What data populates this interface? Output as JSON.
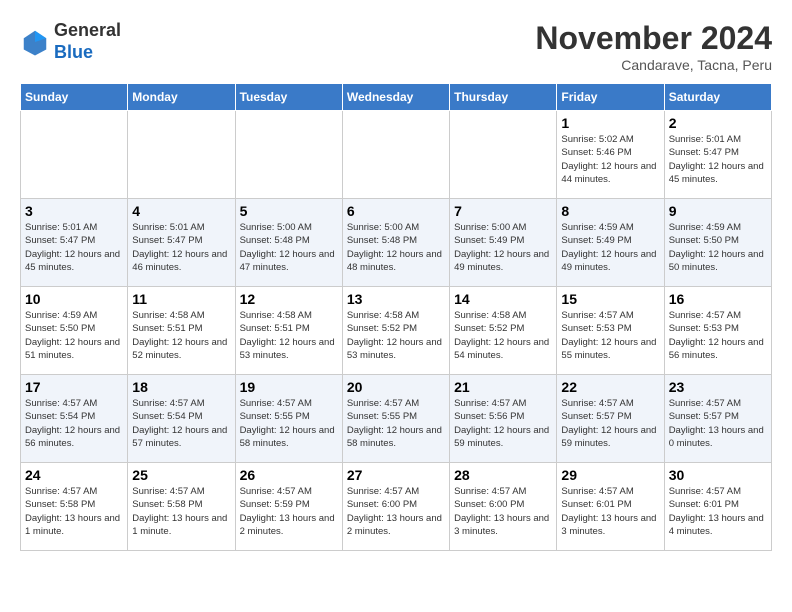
{
  "header": {
    "logo_line1": "General",
    "logo_line2": "Blue",
    "month": "November 2024",
    "location": "Candarave, Tacna, Peru"
  },
  "weekdays": [
    "Sunday",
    "Monday",
    "Tuesday",
    "Wednesday",
    "Thursday",
    "Friday",
    "Saturday"
  ],
  "weeks": [
    [
      {
        "day": "",
        "info": ""
      },
      {
        "day": "",
        "info": ""
      },
      {
        "day": "",
        "info": ""
      },
      {
        "day": "",
        "info": ""
      },
      {
        "day": "",
        "info": ""
      },
      {
        "day": "1",
        "info": "Sunrise: 5:02 AM\nSunset: 5:46 PM\nDaylight: 12 hours\nand 44 minutes."
      },
      {
        "day": "2",
        "info": "Sunrise: 5:01 AM\nSunset: 5:47 PM\nDaylight: 12 hours\nand 45 minutes."
      }
    ],
    [
      {
        "day": "3",
        "info": "Sunrise: 5:01 AM\nSunset: 5:47 PM\nDaylight: 12 hours\nand 45 minutes."
      },
      {
        "day": "4",
        "info": "Sunrise: 5:01 AM\nSunset: 5:47 PM\nDaylight: 12 hours\nand 46 minutes."
      },
      {
        "day": "5",
        "info": "Sunrise: 5:00 AM\nSunset: 5:48 PM\nDaylight: 12 hours\nand 47 minutes."
      },
      {
        "day": "6",
        "info": "Sunrise: 5:00 AM\nSunset: 5:48 PM\nDaylight: 12 hours\nand 48 minutes."
      },
      {
        "day": "7",
        "info": "Sunrise: 5:00 AM\nSunset: 5:49 PM\nDaylight: 12 hours\nand 49 minutes."
      },
      {
        "day": "8",
        "info": "Sunrise: 4:59 AM\nSunset: 5:49 PM\nDaylight: 12 hours\nand 49 minutes."
      },
      {
        "day": "9",
        "info": "Sunrise: 4:59 AM\nSunset: 5:50 PM\nDaylight: 12 hours\nand 50 minutes."
      }
    ],
    [
      {
        "day": "10",
        "info": "Sunrise: 4:59 AM\nSunset: 5:50 PM\nDaylight: 12 hours\nand 51 minutes."
      },
      {
        "day": "11",
        "info": "Sunrise: 4:58 AM\nSunset: 5:51 PM\nDaylight: 12 hours\nand 52 minutes."
      },
      {
        "day": "12",
        "info": "Sunrise: 4:58 AM\nSunset: 5:51 PM\nDaylight: 12 hours\nand 53 minutes."
      },
      {
        "day": "13",
        "info": "Sunrise: 4:58 AM\nSunset: 5:52 PM\nDaylight: 12 hours\nand 53 minutes."
      },
      {
        "day": "14",
        "info": "Sunrise: 4:58 AM\nSunset: 5:52 PM\nDaylight: 12 hours\nand 54 minutes."
      },
      {
        "day": "15",
        "info": "Sunrise: 4:57 AM\nSunset: 5:53 PM\nDaylight: 12 hours\nand 55 minutes."
      },
      {
        "day": "16",
        "info": "Sunrise: 4:57 AM\nSunset: 5:53 PM\nDaylight: 12 hours\nand 56 minutes."
      }
    ],
    [
      {
        "day": "17",
        "info": "Sunrise: 4:57 AM\nSunset: 5:54 PM\nDaylight: 12 hours\nand 56 minutes."
      },
      {
        "day": "18",
        "info": "Sunrise: 4:57 AM\nSunset: 5:54 PM\nDaylight: 12 hours\nand 57 minutes."
      },
      {
        "day": "19",
        "info": "Sunrise: 4:57 AM\nSunset: 5:55 PM\nDaylight: 12 hours\nand 58 minutes."
      },
      {
        "day": "20",
        "info": "Sunrise: 4:57 AM\nSunset: 5:55 PM\nDaylight: 12 hours\nand 58 minutes."
      },
      {
        "day": "21",
        "info": "Sunrise: 4:57 AM\nSunset: 5:56 PM\nDaylight: 12 hours\nand 59 minutes."
      },
      {
        "day": "22",
        "info": "Sunrise: 4:57 AM\nSunset: 5:57 PM\nDaylight: 12 hours\nand 59 minutes."
      },
      {
        "day": "23",
        "info": "Sunrise: 4:57 AM\nSunset: 5:57 PM\nDaylight: 13 hours\nand 0 minutes."
      }
    ],
    [
      {
        "day": "24",
        "info": "Sunrise: 4:57 AM\nSunset: 5:58 PM\nDaylight: 13 hours\nand 1 minute."
      },
      {
        "day": "25",
        "info": "Sunrise: 4:57 AM\nSunset: 5:58 PM\nDaylight: 13 hours\nand 1 minute."
      },
      {
        "day": "26",
        "info": "Sunrise: 4:57 AM\nSunset: 5:59 PM\nDaylight: 13 hours\nand 2 minutes."
      },
      {
        "day": "27",
        "info": "Sunrise: 4:57 AM\nSunset: 6:00 PM\nDaylight: 13 hours\nand 2 minutes."
      },
      {
        "day": "28",
        "info": "Sunrise: 4:57 AM\nSunset: 6:00 PM\nDaylight: 13 hours\nand 3 minutes."
      },
      {
        "day": "29",
        "info": "Sunrise: 4:57 AM\nSunset: 6:01 PM\nDaylight: 13 hours\nand 3 minutes."
      },
      {
        "day": "30",
        "info": "Sunrise: 4:57 AM\nSunset: 6:01 PM\nDaylight: 13 hours\nand 4 minutes."
      }
    ]
  ]
}
